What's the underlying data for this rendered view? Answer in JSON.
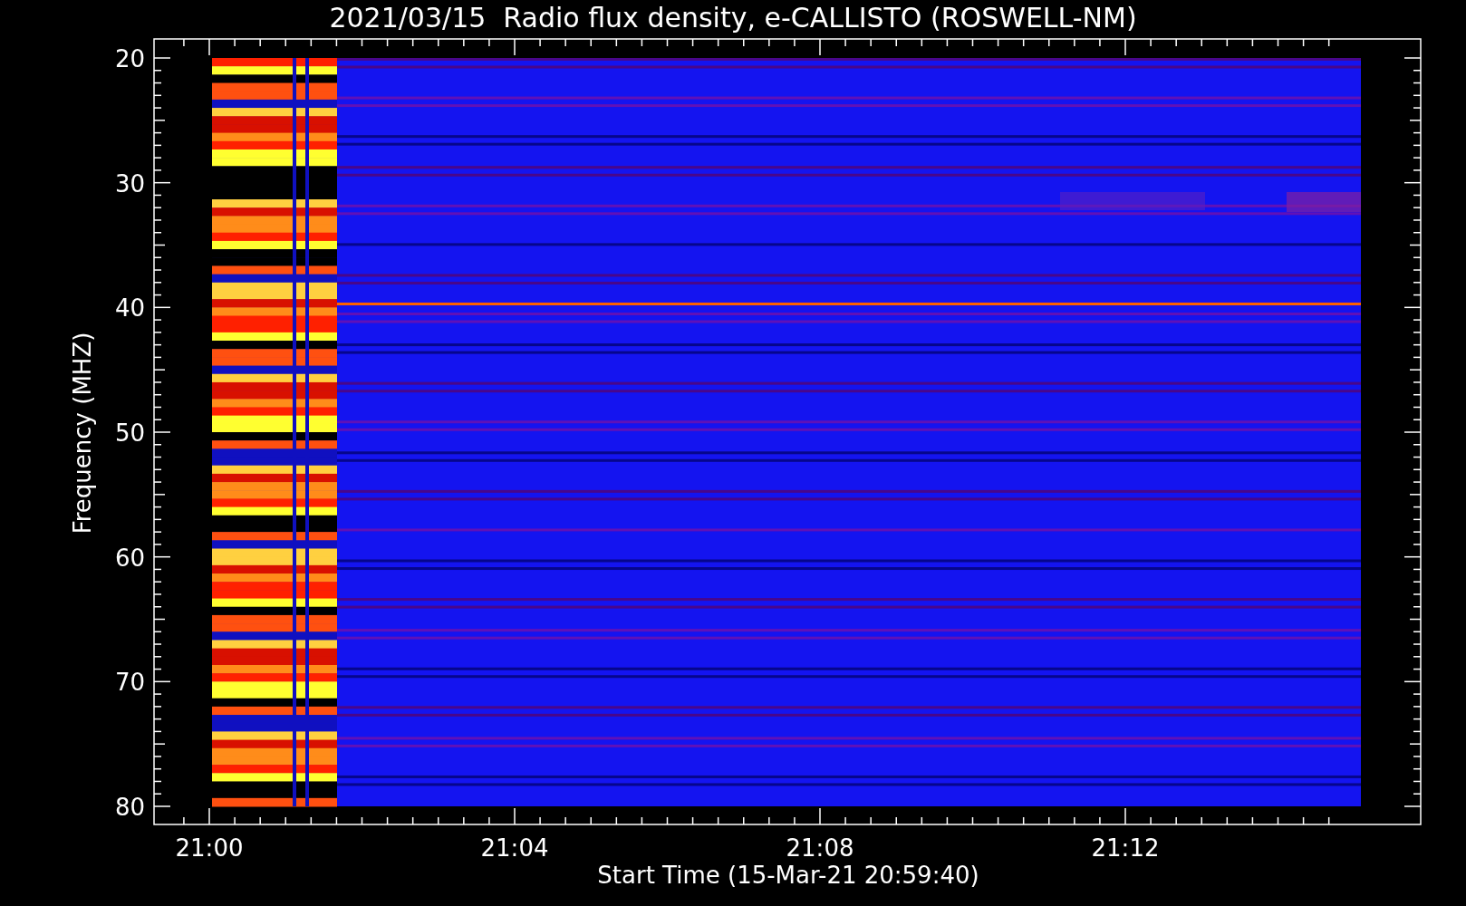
{
  "title": "2021/03/15  Radio flux density, e-CALLISTO (ROSWELL-NM)",
  "y_axis": {
    "label": "Frequency (MHZ)",
    "ticks": [
      "20",
      "30",
      "40",
      "50",
      "60",
      "70",
      "80"
    ]
  },
  "x_axis": {
    "label": "Start Time (15-Mar-21 20:59:40)",
    "ticks": [
      "21:00",
      "21:04",
      "21:08",
      "21:12"
    ]
  }
}
